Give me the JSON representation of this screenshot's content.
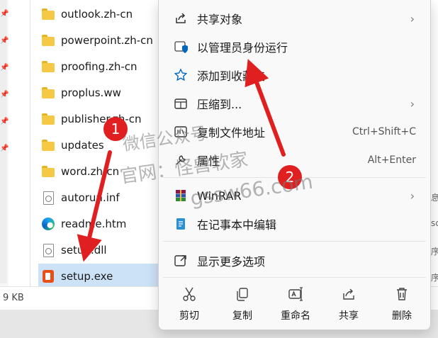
{
  "explorer": {
    "files": [
      {
        "name": "outlook.zh-cn",
        "icon": "folder-icon"
      },
      {
        "name": "powerpoint.zh-cn",
        "icon": "folder-icon"
      },
      {
        "name": "proofing.zh-cn",
        "icon": "folder-icon"
      },
      {
        "name": "proplus.ww",
        "icon": "folder-icon"
      },
      {
        "name": "publisher.zh-cn",
        "icon": "folder-icon"
      },
      {
        "name": "updates",
        "icon": "folder-icon"
      },
      {
        "name": "word.zh-cn",
        "icon": "folder-icon"
      },
      {
        "name": "autorun.inf",
        "icon": "settings-file-icon"
      },
      {
        "name": "readme.htm",
        "icon": "edge-icon"
      },
      {
        "name": "setup.dll",
        "icon": "settings-file-icon"
      },
      {
        "name": "setup.exe",
        "icon": "office-installer-icon",
        "selected": true
      }
    ],
    "right_clipped": {
      "r1": "息",
      "r2": "sc",
      "r3": "序",
      "r4": "序"
    },
    "status_size": "9 KB"
  },
  "context_menu": {
    "items": [
      {
        "label": "共享对象",
        "icon": "share-icon",
        "has_submenu": true
      },
      {
        "label": "以管理员身份运行",
        "icon": "admin-shield-icon"
      },
      {
        "label": "添加到收藏夹",
        "icon": "star-icon"
      },
      {
        "label": "压缩到...",
        "icon": "zip-folder-icon",
        "has_submenu": true
      },
      {
        "label": "复制文件地址",
        "icon": "copy-path-icon",
        "shortcut": "Ctrl+Shift+C"
      },
      {
        "label": "属性",
        "icon": "properties-icon",
        "shortcut": "Alt+Enter"
      },
      {
        "label": "WinRAR",
        "icon": "winrar-icon",
        "has_submenu": true
      },
      {
        "label": "在记事本中编辑",
        "icon": "notepad-icon"
      },
      {
        "label": "显示更多选项",
        "icon": "more-options-icon"
      }
    ],
    "actions": [
      {
        "label": "剪切",
        "icon": "cut-icon"
      },
      {
        "label": "复制",
        "icon": "copy-icon"
      },
      {
        "label": "重命名",
        "icon": "rename-icon"
      },
      {
        "label": "共享",
        "icon": "share-icon"
      },
      {
        "label": "删除",
        "icon": "delete-icon"
      }
    ]
  },
  "annotations": {
    "badge_1": "1",
    "badge_2": "2",
    "watermark_1": "微信公众号",
    "watermark_2": "官网：怪兽软家",
    "watermark_3": "gssw66.com",
    "colors": {
      "badge": "#e02020",
      "arrow": "#e02020",
      "accent": "#0067c0",
      "selection": "#cce2f6"
    }
  }
}
